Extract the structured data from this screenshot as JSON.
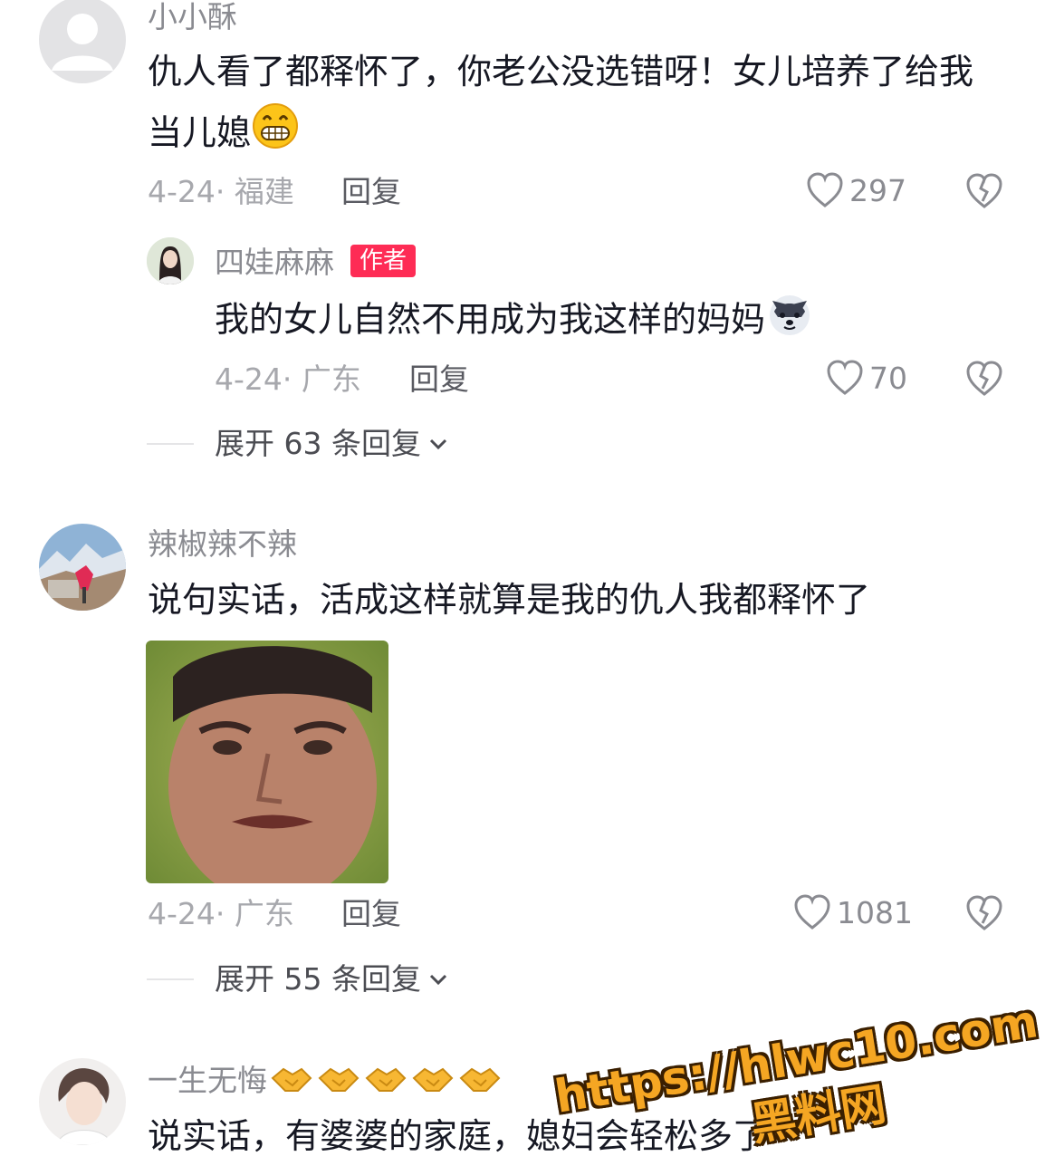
{
  "comments": [
    {
      "username": "小小酥",
      "text_line1": "仇人看了都释怀了，你老公没选错呀！女儿培养了给我",
      "text_line2": "当儿媳",
      "date_location": "4-24· 福建",
      "reply_label": "回复",
      "likes": "297",
      "replies": [
        {
          "username": "四娃麻麻",
          "badge": "作者",
          "text": "我的女儿自然不用成为我这样的妈妈",
          "date_location": "4-24· 广东",
          "reply_label": "回复",
          "likes": "70"
        }
      ],
      "expand_label": "展开 63 条回复"
    },
    {
      "username": "辣椒辣不辣",
      "text": "说句实话，活成这样就算是我的仇人我都释怀了",
      "date_location": "4-24· 广东",
      "reply_label": "回复",
      "likes": "1081",
      "expand_label": "展开 55 条回复"
    },
    {
      "username": "一生无悔",
      "text": "说实话，有婆婆的家庭，媳妇会轻松多了"
    }
  ],
  "watermark": {
    "url": "https://hlwc10.com",
    "site": "黑料网"
  },
  "icons": {
    "like": "heart-outline-icon",
    "dislike": "broken-heart-icon",
    "expand": "chevron-down-icon"
  }
}
